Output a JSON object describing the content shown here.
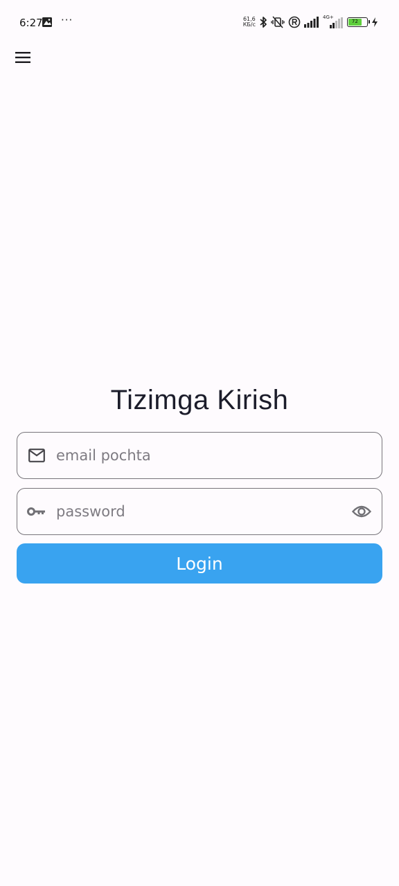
{
  "status_bar": {
    "time": "6:27",
    "net_speed_value": "61,6",
    "net_speed_unit": "КБ/с",
    "network_type": "4G+",
    "battery_level": "72",
    "more_indicator": "···",
    "icons": [
      "photo-notification-icon",
      "bluetooth-icon",
      "vibrate-off-icon",
      "registered-icon",
      "signal-icon",
      "signal-4g-icon",
      "battery-icon",
      "charging-icon"
    ]
  },
  "app_bar": {
    "menu_icon": "menu-icon"
  },
  "login": {
    "title": "Tizimga Kirish",
    "email": {
      "placeholder": "email pochta",
      "value": "",
      "icon": "mail-icon"
    },
    "password": {
      "placeholder": "password",
      "value": "",
      "icon": "key-icon",
      "toggle_icon": "eye-icon"
    },
    "button_label": "Login"
  },
  "colors": {
    "background": "#fefbfe",
    "primary": "#39a3f0",
    "title": "#1b1c2a",
    "outline": "#77747a",
    "placeholder": "#7e7b82",
    "battery": "#5fcf3d"
  }
}
